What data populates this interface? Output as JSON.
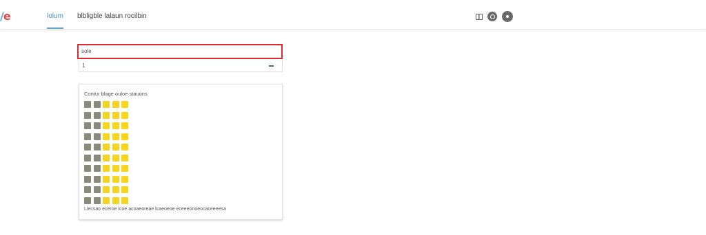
{
  "app": {
    "logo_part1": "/",
    "logo_part2": "e"
  },
  "header": {
    "active_tab": "lolum",
    "breadcrumb": "blbligble lalaun rocilbin",
    "icons": [
      "grid-icon",
      "refresh-icon",
      "user-icon"
    ]
  },
  "form": {
    "highlighted_field_value": "sole",
    "second_field_value": "1"
  },
  "card": {
    "title": "Contur blage ouloe stauons",
    "footer": "Llecsao eceroe lcoe acoaeoreae lcaeoeoe eceeeonoeocaceeeesa",
    "colors": {
      "gray": "#8a8a7a",
      "yellow": "#f5d51e"
    },
    "grid": {
      "rows": 10,
      "pattern": [
        "gray",
        "gray",
        "yellow",
        "yellow",
        "yellow"
      ]
    }
  },
  "theme": {
    "accent": "#5aa7d6",
    "highlight": "#e02b36"
  }
}
